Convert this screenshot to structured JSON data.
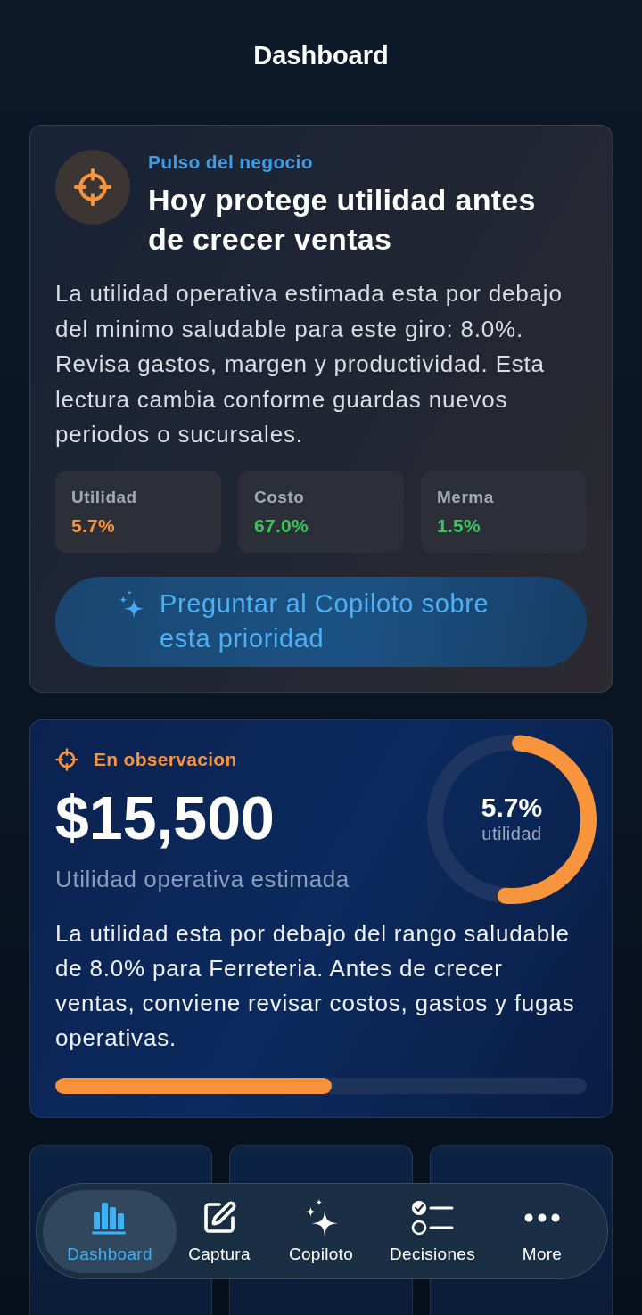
{
  "header": {
    "title": "Dashboard"
  },
  "priority_card": {
    "eyebrow": "Pulso del negocio",
    "title": "Hoy protege utilidad antes de crecer ventas",
    "body": "La utilidad operativa estimada esta por debajo del minimo saludable para este giro: 8.0%. Revisa gastos, margen y productividad. Esta lectura cambia conforme guardas nuevos periodos o sucursales.",
    "metrics": [
      {
        "label": "Utilidad",
        "value": "5.7%",
        "color": "#f7943c"
      },
      {
        "label": "Costo",
        "value": "67.0%",
        "color": "#3cc35c"
      },
      {
        "label": "Merma",
        "value": "1.5%",
        "color": "#3cc35c"
      }
    ],
    "action": {
      "label": "Preguntar al Copiloto sobre esta prioridad"
    }
  },
  "profit_card": {
    "status": "En observacion",
    "amount": "$15,500",
    "amount_label": "Utilidad operativa estimada",
    "ring": {
      "value": "5.7%",
      "label": "utilidad",
      "level": 0.53
    },
    "body": "La utilidad esta por debajo del rango saludable de 8.0% para Ferreteria. Antes de crecer ventas, conviene revisar costos, gastos y fugas operativas.",
    "progress": {
      "level": 0.52
    }
  },
  "tab_bar": {
    "items": [
      {
        "kind": "chart",
        "label": "Dashboard",
        "selected": true
      },
      {
        "kind": "edit",
        "label": "Captura",
        "selected": false
      },
      {
        "kind": "sparkles",
        "label": "Copiloto",
        "selected": false
      },
      {
        "kind": "checklist",
        "label": "Decisiones",
        "selected": false
      },
      {
        "kind": "more",
        "label": "More",
        "selected": false
      }
    ]
  }
}
